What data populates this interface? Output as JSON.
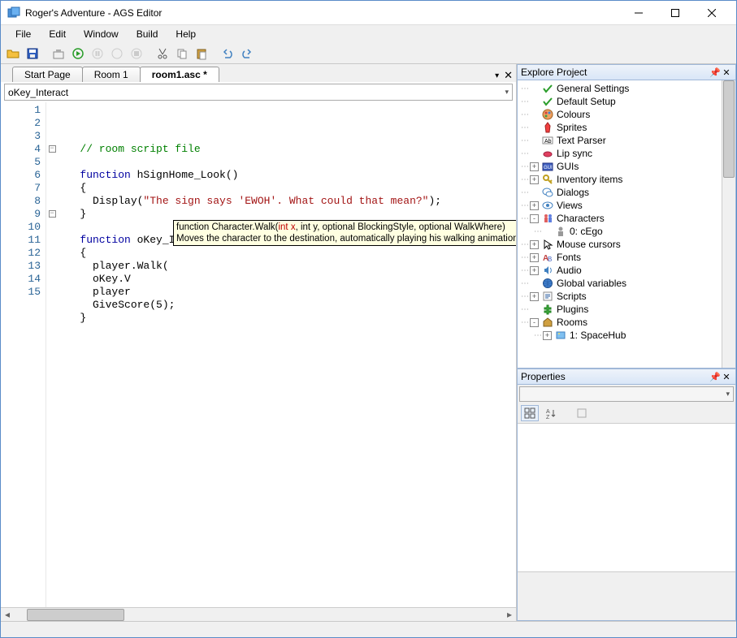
{
  "window": {
    "title": "Roger's Adventure - AGS Editor"
  },
  "menubar": [
    "File",
    "Edit",
    "Window",
    "Build",
    "Help"
  ],
  "tabs": [
    {
      "label": "Start Page",
      "active": false
    },
    {
      "label": "Room 1",
      "active": false
    },
    {
      "label": "room1.asc *",
      "active": true
    }
  ],
  "navCombo": "oKey_Interact",
  "code": {
    "lines": [
      {
        "n": 1,
        "seg": [
          {
            "t": "   ",
            "c": ""
          },
          {
            "t": "// room script file",
            "c": "c-comment"
          }
        ]
      },
      {
        "n": 2,
        "seg": [
          {
            "t": " ",
            "c": ""
          }
        ]
      },
      {
        "n": 3,
        "seg": [
          {
            "t": "   ",
            "c": ""
          },
          {
            "t": "function",
            "c": "c-key"
          },
          {
            "t": " hSignHome_Look()",
            "c": ""
          }
        ]
      },
      {
        "n": 4,
        "seg": [
          {
            "t": "   {",
            "c": ""
          }
        ],
        "fold": "-"
      },
      {
        "n": 5,
        "seg": [
          {
            "t": "     Display(",
            "c": ""
          },
          {
            "t": "\"The sign says 'EWOH'. What could that mean?\"",
            "c": "c-str"
          },
          {
            "t": ");",
            "c": ""
          }
        ]
      },
      {
        "n": 6,
        "seg": [
          {
            "t": "   }",
            "c": ""
          }
        ]
      },
      {
        "n": 7,
        "seg": [
          {
            "t": " ",
            "c": ""
          }
        ]
      },
      {
        "n": 8,
        "seg": [
          {
            "t": "   ",
            "c": ""
          },
          {
            "t": "function",
            "c": "c-key"
          },
          {
            "t": " oKey_Interact()",
            "c": ""
          }
        ]
      },
      {
        "n": 9,
        "seg": [
          {
            "t": "   {",
            "c": ""
          }
        ],
        "fold": "-"
      },
      {
        "n": 10,
        "seg": [
          {
            "t": "     player.Walk(",
            "c": ""
          }
        ]
      },
      {
        "n": 11,
        "seg": [
          {
            "t": "     oKey.V",
            "c": ""
          }
        ]
      },
      {
        "n": 12,
        "seg": [
          {
            "t": "     player",
            "c": ""
          }
        ]
      },
      {
        "n": 13,
        "seg": [
          {
            "t": "     GiveScore(5);",
            "c": ""
          }
        ]
      },
      {
        "n": 14,
        "seg": [
          {
            "t": "   }",
            "c": ""
          }
        ]
      },
      {
        "n": 15,
        "seg": [
          {
            "t": " ",
            "c": ""
          }
        ]
      }
    ]
  },
  "tooltip": {
    "sig_prefix": "function Character.Walk(",
    "sig_hilite": "int x",
    "sig_suffix": ", int y, optional BlockingStyle, optional WalkWhere)",
    "desc": "Moves the character to the destination, automatically playing his walking animation."
  },
  "explore": {
    "title": "Explore Project",
    "items": [
      {
        "indent": 1,
        "exp": "",
        "icon": "check",
        "label": "General Settings"
      },
      {
        "indent": 1,
        "exp": "",
        "icon": "check",
        "label": "Default Setup"
      },
      {
        "indent": 1,
        "exp": "",
        "icon": "palette",
        "label": "Colours"
      },
      {
        "indent": 1,
        "exp": "",
        "icon": "sprite",
        "label": "Sprites"
      },
      {
        "indent": 1,
        "exp": "",
        "icon": "ab",
        "label": "Text Parser"
      },
      {
        "indent": 1,
        "exp": "",
        "icon": "lips",
        "label": "Lip sync"
      },
      {
        "indent": 1,
        "exp": "+",
        "icon": "gui",
        "label": "GUIs"
      },
      {
        "indent": 1,
        "exp": "+",
        "icon": "key",
        "label": "Inventory items"
      },
      {
        "indent": 1,
        "exp": "",
        "icon": "dialog",
        "label": "Dialogs"
      },
      {
        "indent": 1,
        "exp": "+",
        "icon": "eye",
        "label": "Views"
      },
      {
        "indent": 1,
        "exp": "-",
        "icon": "chars",
        "label": "Characters"
      },
      {
        "indent": 2,
        "exp": "",
        "icon": "char",
        "label": "0: cEgo"
      },
      {
        "indent": 1,
        "exp": "+",
        "icon": "cursor",
        "label": "Mouse cursors"
      },
      {
        "indent": 1,
        "exp": "+",
        "icon": "font",
        "label": "Fonts"
      },
      {
        "indent": 1,
        "exp": "+",
        "icon": "audio",
        "label": "Audio"
      },
      {
        "indent": 1,
        "exp": "",
        "icon": "globe",
        "label": "Global variables"
      },
      {
        "indent": 1,
        "exp": "+",
        "icon": "script",
        "label": "Scripts"
      },
      {
        "indent": 1,
        "exp": "",
        "icon": "plugin",
        "label": "Plugins"
      },
      {
        "indent": 1,
        "exp": "-",
        "icon": "rooms",
        "label": "Rooms"
      },
      {
        "indent": 2,
        "exp": "+",
        "icon": "room",
        "label": "1: SpaceHub"
      }
    ]
  },
  "properties": {
    "title": "Properties"
  }
}
